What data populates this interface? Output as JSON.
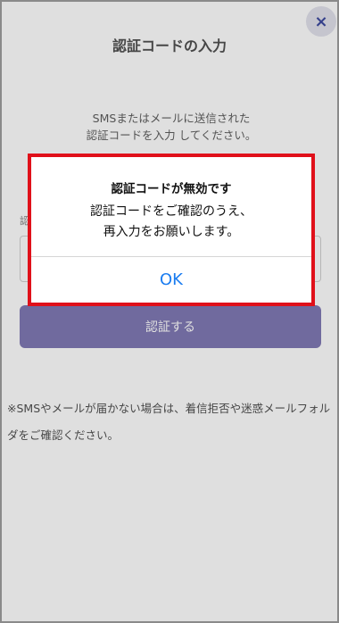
{
  "header": {
    "title": "認証コードの入力",
    "close_icon": "×"
  },
  "main": {
    "instruction": "SMSまたはメールに送信された\n認証コードを入力 してください。",
    "code_label": "認",
    "verify_button": "認証する",
    "note": "※SMSやメールが届かない場合は、着信拒否や迷惑メールフォルダをご確認ください。"
  },
  "dialog": {
    "title": "認証コードが無効です",
    "message": "認証コードをご確認のうえ、\n再入力をお願いします。",
    "ok_label": "OK"
  },
  "colors": {
    "accent": "#6b63a8",
    "highlight_border": "#e0101a",
    "link_blue": "#1a7cf0"
  }
}
